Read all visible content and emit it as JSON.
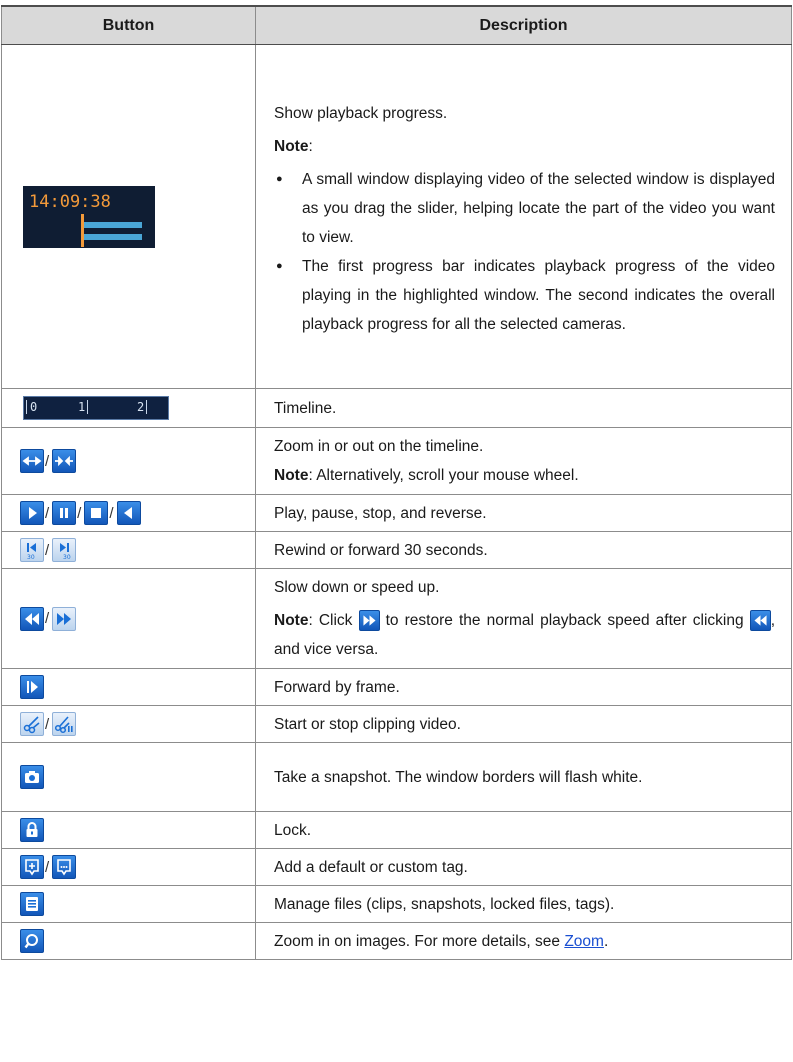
{
  "header": {
    "col_button": "Button",
    "col_description": "Description"
  },
  "progress_widget": {
    "time": "14:09:38",
    "played_fraction": 0.45
  },
  "timeline_widget": {
    "ticks": [
      "0",
      "1",
      "2"
    ]
  },
  "rows": {
    "progress": {
      "text": "Show playback progress.",
      "note_label": "Note",
      "note_colon": ":",
      "bullet1": "A small window displaying video of the selected window is displayed as you drag the slider, helping locate the part of the video you want to view.",
      "bullet2": "The first progress bar indicates playback progress of the video playing in the highlighted window. The second indicates the overall playback progress for all the selected cameras."
    },
    "timeline": {
      "text": "Timeline."
    },
    "zoom_timeline": {
      "text": "Zoom in or out on the timeline.",
      "note_label": "Note",
      "note_text": ": Alternatively, scroll your mouse wheel."
    },
    "play_controls": {
      "text": "Play, pause, stop, and reverse."
    },
    "skip": {
      "text": "Rewind or forward 30 seconds."
    },
    "speed": {
      "text": "Slow down or speed up.",
      "note_label": "Note",
      "note_pre": ": Click",
      "note_mid": "to restore the normal playback speed after clicking",
      "note_post": ", and vice versa."
    },
    "frame": {
      "text": "Forward by frame."
    },
    "clip": {
      "text": "Start or stop clipping video."
    },
    "snapshot": {
      "text": "Take a snapshot. The window borders will flash white."
    },
    "lock": {
      "text": "Lock."
    },
    "tag": {
      "text": "Add a default or custom tag."
    },
    "files": {
      "text": "Manage files (clips, snapshots, locked files, tags)."
    },
    "zoom_image": {
      "text_pre": "Zoom in on images. For more details, see",
      "link": "Zoom",
      "text_post": "."
    }
  },
  "separator": "/",
  "icons": {
    "zoom_in": "arrows-apart-icon",
    "zoom_out": "arrows-together-icon",
    "play": "play-icon",
    "pause": "pause-icon",
    "stop": "stop-icon",
    "reverse": "reverse-icon",
    "rewind30": "rewind-30-icon",
    "forward30": "forward-30-icon",
    "slow": "slow-down-icon",
    "fast": "speed-up-icon",
    "frame": "frame-forward-icon",
    "clip_start": "scissors-icon",
    "clip_stop": "scissors-stop-icon",
    "snapshot": "camera-icon",
    "lock": "lock-icon",
    "tag_default": "tag-add-icon",
    "tag_custom": "tag-custom-icon",
    "files": "file-manager-icon",
    "zoom": "magnifier-icon"
  },
  "colors": {
    "icon_blue": "#1a6fd6",
    "progress_orange": "#f39a3a",
    "progress_bar": "#4aa6d6",
    "link": "#1a4fd1"
  }
}
